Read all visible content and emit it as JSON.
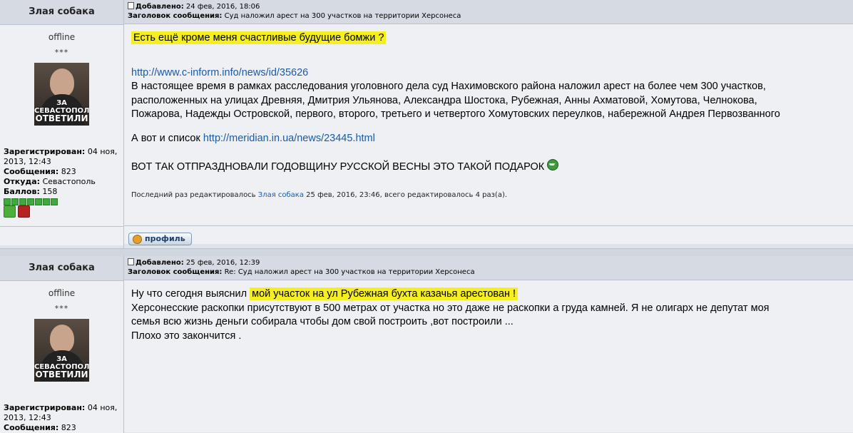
{
  "posts": [
    {
      "author": "Злая собака",
      "added_label": "Добавлено:",
      "added_date": "24 фев, 2016, 18:06",
      "subject_label": "Заголовок сообщения:",
      "subject": "Суд наложил арест на 300 участков на территории Херсонеса",
      "status": "offline",
      "rank_stars": "***",
      "avatar_text": [
        "ЗА",
        "СЕВАСТОПОЛЬ",
        "ОТВЕТИЛИ"
      ],
      "registered_label": "Зарегистрирован:",
      "registered": "04 ноя, 2013, 12:43",
      "messages_label": "Сообщения:",
      "messages": "823",
      "from_label": "Откуда:",
      "from": "Севастополь",
      "score_label": "Баллов:",
      "score": "158",
      "body": {
        "highlight1": "Есть ещё кроме меня счастливые будущие бомжи ?",
        "link1": "http://www.c-inform.info/news/id/35626",
        "para1_l1": "В настоящее время в рамках расследования уголовного дела суд Нахимовского района наложил арест на более чем 300 участков,",
        "para1_l2": "расположенных на улицах Древняя, Дмитрия Ульянова, Александра Шостока, Рубежная, Анны Ахматовой, Хомутова, Челнокова,",
        "para1_l3": "Пожарова, Надежды Островской, первого, второго, третьего и четвертого Хомутовских переулков, набережной Андрея Первозванного",
        "list_prefix": "А вот и список",
        "link2": "http://meridian.in.ua/news/23445.html",
        "caps": "ВОТ ТАК ОТПРАЗДНОВАЛИ ГОДОВЩИНУ РУССКОЙ ВЕСНЫ ЭТО ТАКОЙ ПОДАРОК",
        "edit_prefix": "Последний раз редактировалось",
        "edit_user": "Злая собака",
        "edit_suffix": "25 фев, 2016, 23:46, всего редактировалось 4 раз(а)."
      },
      "profile_button": "профиль"
    },
    {
      "author": "Злая собака",
      "added_label": "Добавлено:",
      "added_date": "25 фев, 2016, 12:39",
      "subject_label": "Заголовок сообщения:",
      "subject": "Re: Суд наложил арест на 300 участков на территории Херсонеса",
      "status": "offline",
      "rank_stars": "***",
      "avatar_text": [
        "ЗА",
        "СЕВАСТОПОЛЬ",
        "ОТВЕТИЛИ"
      ],
      "registered_label": "Зарегистрирован:",
      "registered": "04 ноя, 2013, 12:43",
      "messages_label": "Сообщения:",
      "messages": "823",
      "body": {
        "line1_prefix": "Ну что сегодня выяснил",
        "line1_highlight": "мой участок на ул Рубежная бухта казачья арестован !",
        "line2": "Херсонесские раскопки присутствуют в 500 метрах от участка но это даже не раскопки а груда камней. Я не олигарх не депутат моя",
        "line3": "семья всю жизнь деньги собирала чтобы дом свой построить ,вот построили ...",
        "line4": "Плохо это закончится ."
      }
    }
  ],
  "colors": {
    "header_bg": "#d6dbe3",
    "body_bg": "#eef0f3",
    "highlight": "#f5ef21",
    "link": "#1a5aa8"
  }
}
